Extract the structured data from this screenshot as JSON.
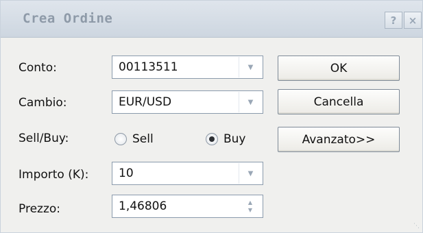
{
  "window": {
    "title": "Crea Ordine",
    "help_label": "?",
    "close_label": "×"
  },
  "form": {
    "account": {
      "label": "Conto:",
      "value": "00113511"
    },
    "symbol": {
      "label": "Cambio:",
      "value": "EUR/USD"
    },
    "side": {
      "label": "Sell/Buy:",
      "sell_label": "Sell",
      "buy_label": "Buy",
      "selected": "Buy"
    },
    "amount": {
      "label": "Importo (K):",
      "value": "10"
    },
    "price": {
      "label": "Prezzo:",
      "value": "1,46806"
    }
  },
  "buttons": {
    "ok": "OK",
    "cancel": "Cancella",
    "advanced": "Avanzato>>"
  },
  "icons": {
    "dropdown": "chevron-down-icon",
    "spinner": "spinner-icon",
    "resize": "resize-grip-icon"
  },
  "colors": {
    "title_text": "#8e9aa8",
    "titlebar_bg": "#d6dde6",
    "dialog_bg": "#f0f0ee"
  }
}
